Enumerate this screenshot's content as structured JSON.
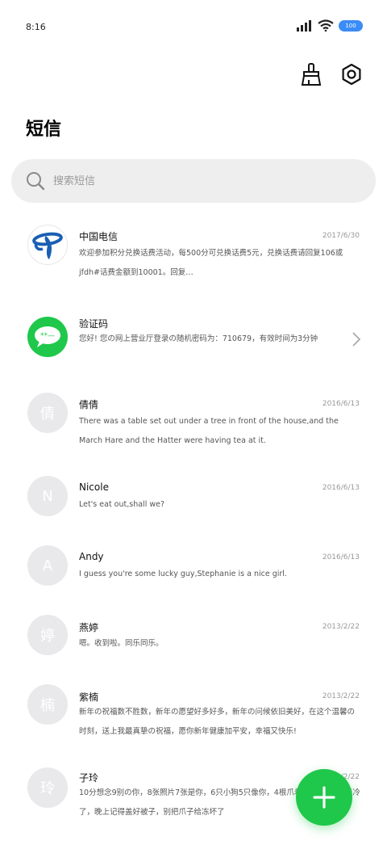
{
  "status_bar": {
    "time": "8:16",
    "battery": "100"
  },
  "header": {
    "title": "短信"
  },
  "search": {
    "placeholder": "搜索短信"
  },
  "messages": [
    {
      "name": "中国电信",
      "date": "2017/6/30",
      "preview": "欢迎参加积分兑换话费活动，每500分可兑换话费5元，兑换话费请回复106或jfdh#话费金额到10001。回复…",
      "avatar": "telecom-logo"
    },
    {
      "name": "验证码",
      "date": "",
      "preview": "您好! 您の网上营业厅登录の随机密码为：710679，有效时间为3分钟",
      "avatar": "sms-icon"
    },
    {
      "name": "倩倩",
      "date": "2016/6/13",
      "preview": "There was a table set out under a tree in front of the house,and the March Hare and the Hatter were having tea at it.",
      "avatar_letter": "倩"
    },
    {
      "name": "Nicole",
      "date": "2016/6/13",
      "preview": "Let's eat out,shall we?",
      "avatar_letter": "N"
    },
    {
      "name": "Andy",
      "date": "2016/6/13",
      "preview": "I guess you're some lucky guy,Stephanie is a nice girl.",
      "avatar_letter": "A"
    },
    {
      "name": "燕婷",
      "date": "2013/2/22",
      "preview": "嗯。收到啦。同乐同乐。",
      "avatar_letter": "婷"
    },
    {
      "name": "紫楠",
      "date": "2013/2/22",
      "preview": "新年の祝福数不胜数，新年の愿望好多好多，新年の问候依旧美好，在这个温馨の时刻，送上我最真挚の祝福，愿你新年健康加平安，幸福又快乐!",
      "avatar_letter": "楠"
    },
    {
      "name": "子玲",
      "date": "2013/2/22",
      "preview": "10分想念9别の你，8张照片7张是你，6只小狗5只像你，4根爪着地2定是你，天冷了，晚上记得盖好被子，别把爪子给冻坏了",
      "avatar_letter": "玲"
    }
  ],
  "colors": {
    "accent": "#1fc84a",
    "telecom": "#1a5fb4",
    "battery": "#3b8cf6"
  }
}
